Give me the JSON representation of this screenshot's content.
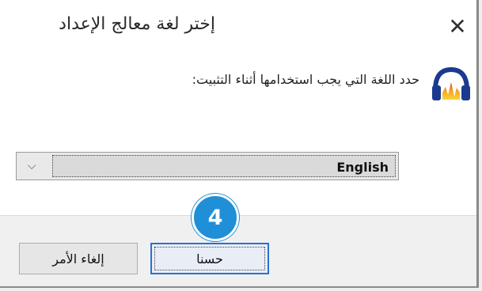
{
  "dialog": {
    "title": "إختر لغة معالج الإعداد",
    "message": "حدد اللغة التي يجب استخدامها أثناء التثبيت:",
    "close_glyph": "✕",
    "app_icon": "headphones-icon"
  },
  "language_select": {
    "selected": "English",
    "chevron_glyph": "⌵"
  },
  "buttons": {
    "ok_label": "حسنا",
    "cancel_label": "إلغاء الأمر"
  },
  "annotation": {
    "step_number": "4",
    "color": "#1f8fd8"
  },
  "colors": {
    "focus_border": "#2b6fd6"
  }
}
